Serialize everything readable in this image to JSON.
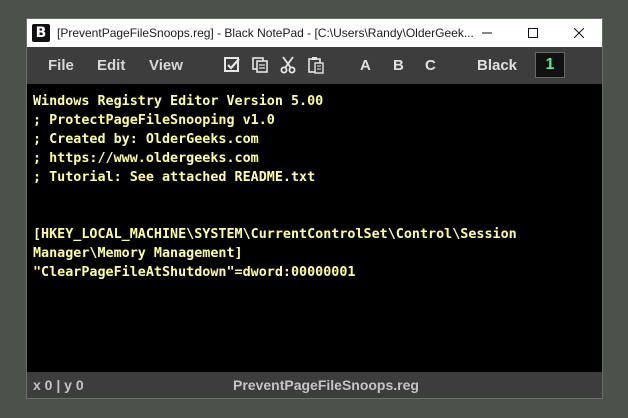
{
  "window": {
    "app_icon_glyph": "B",
    "title": "[PreventPageFileSnoops.reg] - Black NotePad - [C:\\Users\\Randy\\OlderGeek..."
  },
  "menu": {
    "file": "File",
    "edit": "Edit",
    "view": "View",
    "tools": [
      "check-square-icon",
      "copy-icon",
      "scissors-icon",
      "paste-icon"
    ],
    "theme_a": "A",
    "theme_b": "B",
    "theme_c": "C",
    "theme_label": "Black",
    "counter": "1"
  },
  "editor": {
    "lines": [
      "Windows Registry Editor Version 5.00",
      "; ProtectPageFileSnooping v1.0",
      "; Created by: OlderGeeks.com",
      "; https://www.oldergeeks.com",
      "; Tutorial: See attached README.txt",
      "",
      "",
      "[HKEY_LOCAL_MACHINE\\SYSTEM\\CurrentControlSet\\Control\\Session",
      "Manager\\Memory Management]",
      "\"ClearPageFileAtShutdown\"=dword:00000001"
    ]
  },
  "status": {
    "position": "x 0 | y 0",
    "filename": "PreventPageFileSnoops.reg"
  },
  "colors": {
    "editor_text": "#ffff99",
    "counter_text": "#4cf0a4",
    "toolbar_bg": "#3d3d3d",
    "desktop_bg": "#4b5249"
  }
}
